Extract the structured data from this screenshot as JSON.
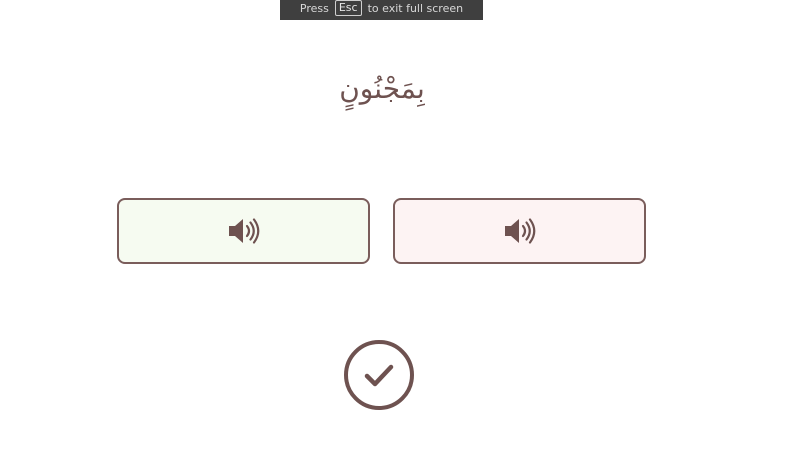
{
  "fullscreen_toast": {
    "prefix": "Press",
    "key": "Esc",
    "suffix": "to exit full screen"
  },
  "word": {
    "arabic": "بِمَجْنُونٍ"
  },
  "options": [
    {
      "icon": "speaker-icon",
      "state": "correct",
      "color": "#f6fbf1"
    },
    {
      "icon": "speaker-icon",
      "state": "incorrect",
      "color": "#fdf3f3"
    }
  ],
  "check_button": {
    "icon": "checkmark-icon",
    "color": "#6e5250"
  },
  "colors": {
    "accent": "#6e5250",
    "border": "#7a5d5b",
    "toast_bg": "#3f3f3f"
  }
}
